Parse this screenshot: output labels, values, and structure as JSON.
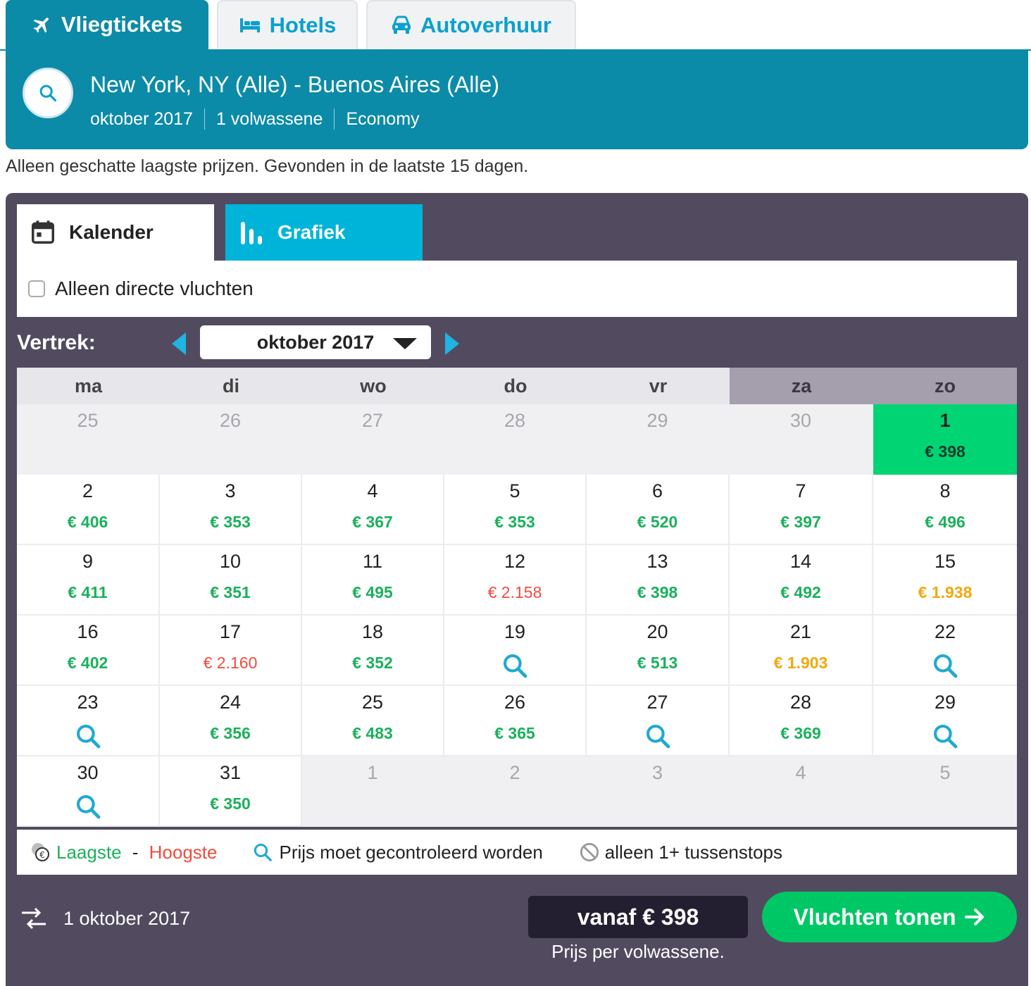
{
  "top_tabs": [
    {
      "label": "Vliegtickets",
      "icon": "plane-icon",
      "active": true
    },
    {
      "label": "Hotels",
      "icon": "bed-icon",
      "active": false
    },
    {
      "label": "Autoverhuur",
      "icon": "car-icon",
      "active": false
    }
  ],
  "summary": {
    "route": "New York, NY (Alle) - Buenos Aires (Alle)",
    "month": "oktober 2017",
    "passengers": "1 volwassene",
    "cabin": "Economy"
  },
  "notice": "Alleen geschatte laagste prijzen. Gevonden in de laatste 15 dagen.",
  "view_tabs": {
    "calendar": "Kalender",
    "chart": "Grafiek"
  },
  "direct_only": {
    "label": "Alleen directe vluchten",
    "checked": false
  },
  "departure": {
    "label": "Vertrek:",
    "month": "oktober 2017"
  },
  "weekdays": [
    "ma",
    "di",
    "wo",
    "do",
    "vr",
    "za",
    "zo"
  ],
  "weeks": [
    [
      {
        "d": "25",
        "other": true
      },
      {
        "d": "26",
        "other": true
      },
      {
        "d": "27",
        "other": true
      },
      {
        "d": "28",
        "other": true
      },
      {
        "d": "29",
        "other": true
      },
      {
        "d": "30",
        "other": true
      },
      {
        "d": "1",
        "price": "€ 398",
        "level": "low",
        "selected": true
      }
    ],
    [
      {
        "d": "2",
        "price": "€ 406",
        "level": "low"
      },
      {
        "d": "3",
        "price": "€ 353",
        "level": "low"
      },
      {
        "d": "4",
        "price": "€ 367",
        "level": "low"
      },
      {
        "d": "5",
        "price": "€ 353",
        "level": "low"
      },
      {
        "d": "6",
        "price": "€ 520",
        "level": "low"
      },
      {
        "d": "7",
        "price": "€ 397",
        "level": "low"
      },
      {
        "d": "8",
        "price": "€ 496",
        "level": "low"
      }
    ],
    [
      {
        "d": "9",
        "price": "€ 411",
        "level": "low"
      },
      {
        "d": "10",
        "price": "€ 351",
        "level": "low"
      },
      {
        "d": "11",
        "price": "€ 495",
        "level": "low"
      },
      {
        "d": "12",
        "price": "€ 2.158",
        "level": "high"
      },
      {
        "d": "13",
        "price": "€ 398",
        "level": "low"
      },
      {
        "d": "14",
        "price": "€ 492",
        "level": "low"
      },
      {
        "d": "15",
        "price": "€ 1.938",
        "level": "mid"
      }
    ],
    [
      {
        "d": "16",
        "price": "€ 402",
        "level": "low"
      },
      {
        "d": "17",
        "price": "€ 2.160",
        "level": "high"
      },
      {
        "d": "18",
        "price": "€ 352",
        "level": "low"
      },
      {
        "d": "19",
        "check": true
      },
      {
        "d": "20",
        "price": "€ 513",
        "level": "low"
      },
      {
        "d": "21",
        "price": "€ 1.903",
        "level": "mid"
      },
      {
        "d": "22",
        "check": true
      }
    ],
    [
      {
        "d": "23",
        "check": true
      },
      {
        "d": "24",
        "price": "€ 356",
        "level": "low"
      },
      {
        "d": "25",
        "price": "€ 483",
        "level": "low"
      },
      {
        "d": "26",
        "price": "€ 365",
        "level": "low"
      },
      {
        "d": "27",
        "check": true
      },
      {
        "d": "28",
        "price": "€ 369",
        "level": "low"
      },
      {
        "d": "29",
        "check": true
      }
    ],
    [
      {
        "d": "30",
        "check": true
      },
      {
        "d": "31",
        "price": "€ 350",
        "level": "low"
      },
      {
        "d": "1",
        "other": true
      },
      {
        "d": "2",
        "other": true
      },
      {
        "d": "3",
        "other": true
      },
      {
        "d": "4",
        "other": true
      },
      {
        "d": "5",
        "other": true
      }
    ]
  ],
  "legend": {
    "lowest": "Laagste",
    "dash": " - ",
    "highest": "Hoogste",
    "check": "Prijs moet gecontroleerd worden",
    "stops": "alleen 1+ tussenstops"
  },
  "footer": {
    "date": "1 oktober 2017",
    "price": "vanaf € 398",
    "per_adult": "Prijs per volwassene.",
    "cta": "Vluchten tonen"
  },
  "colors": {
    "brand_teal": "#0b8ba8",
    "tab_cyan": "#00b3d9",
    "panel": "#524b5f",
    "price_low": "#1ab15b",
    "price_mid": "#f2a80d",
    "price_high": "#f24b3d",
    "selected_day": "#00d473",
    "cta": "#00c765"
  }
}
